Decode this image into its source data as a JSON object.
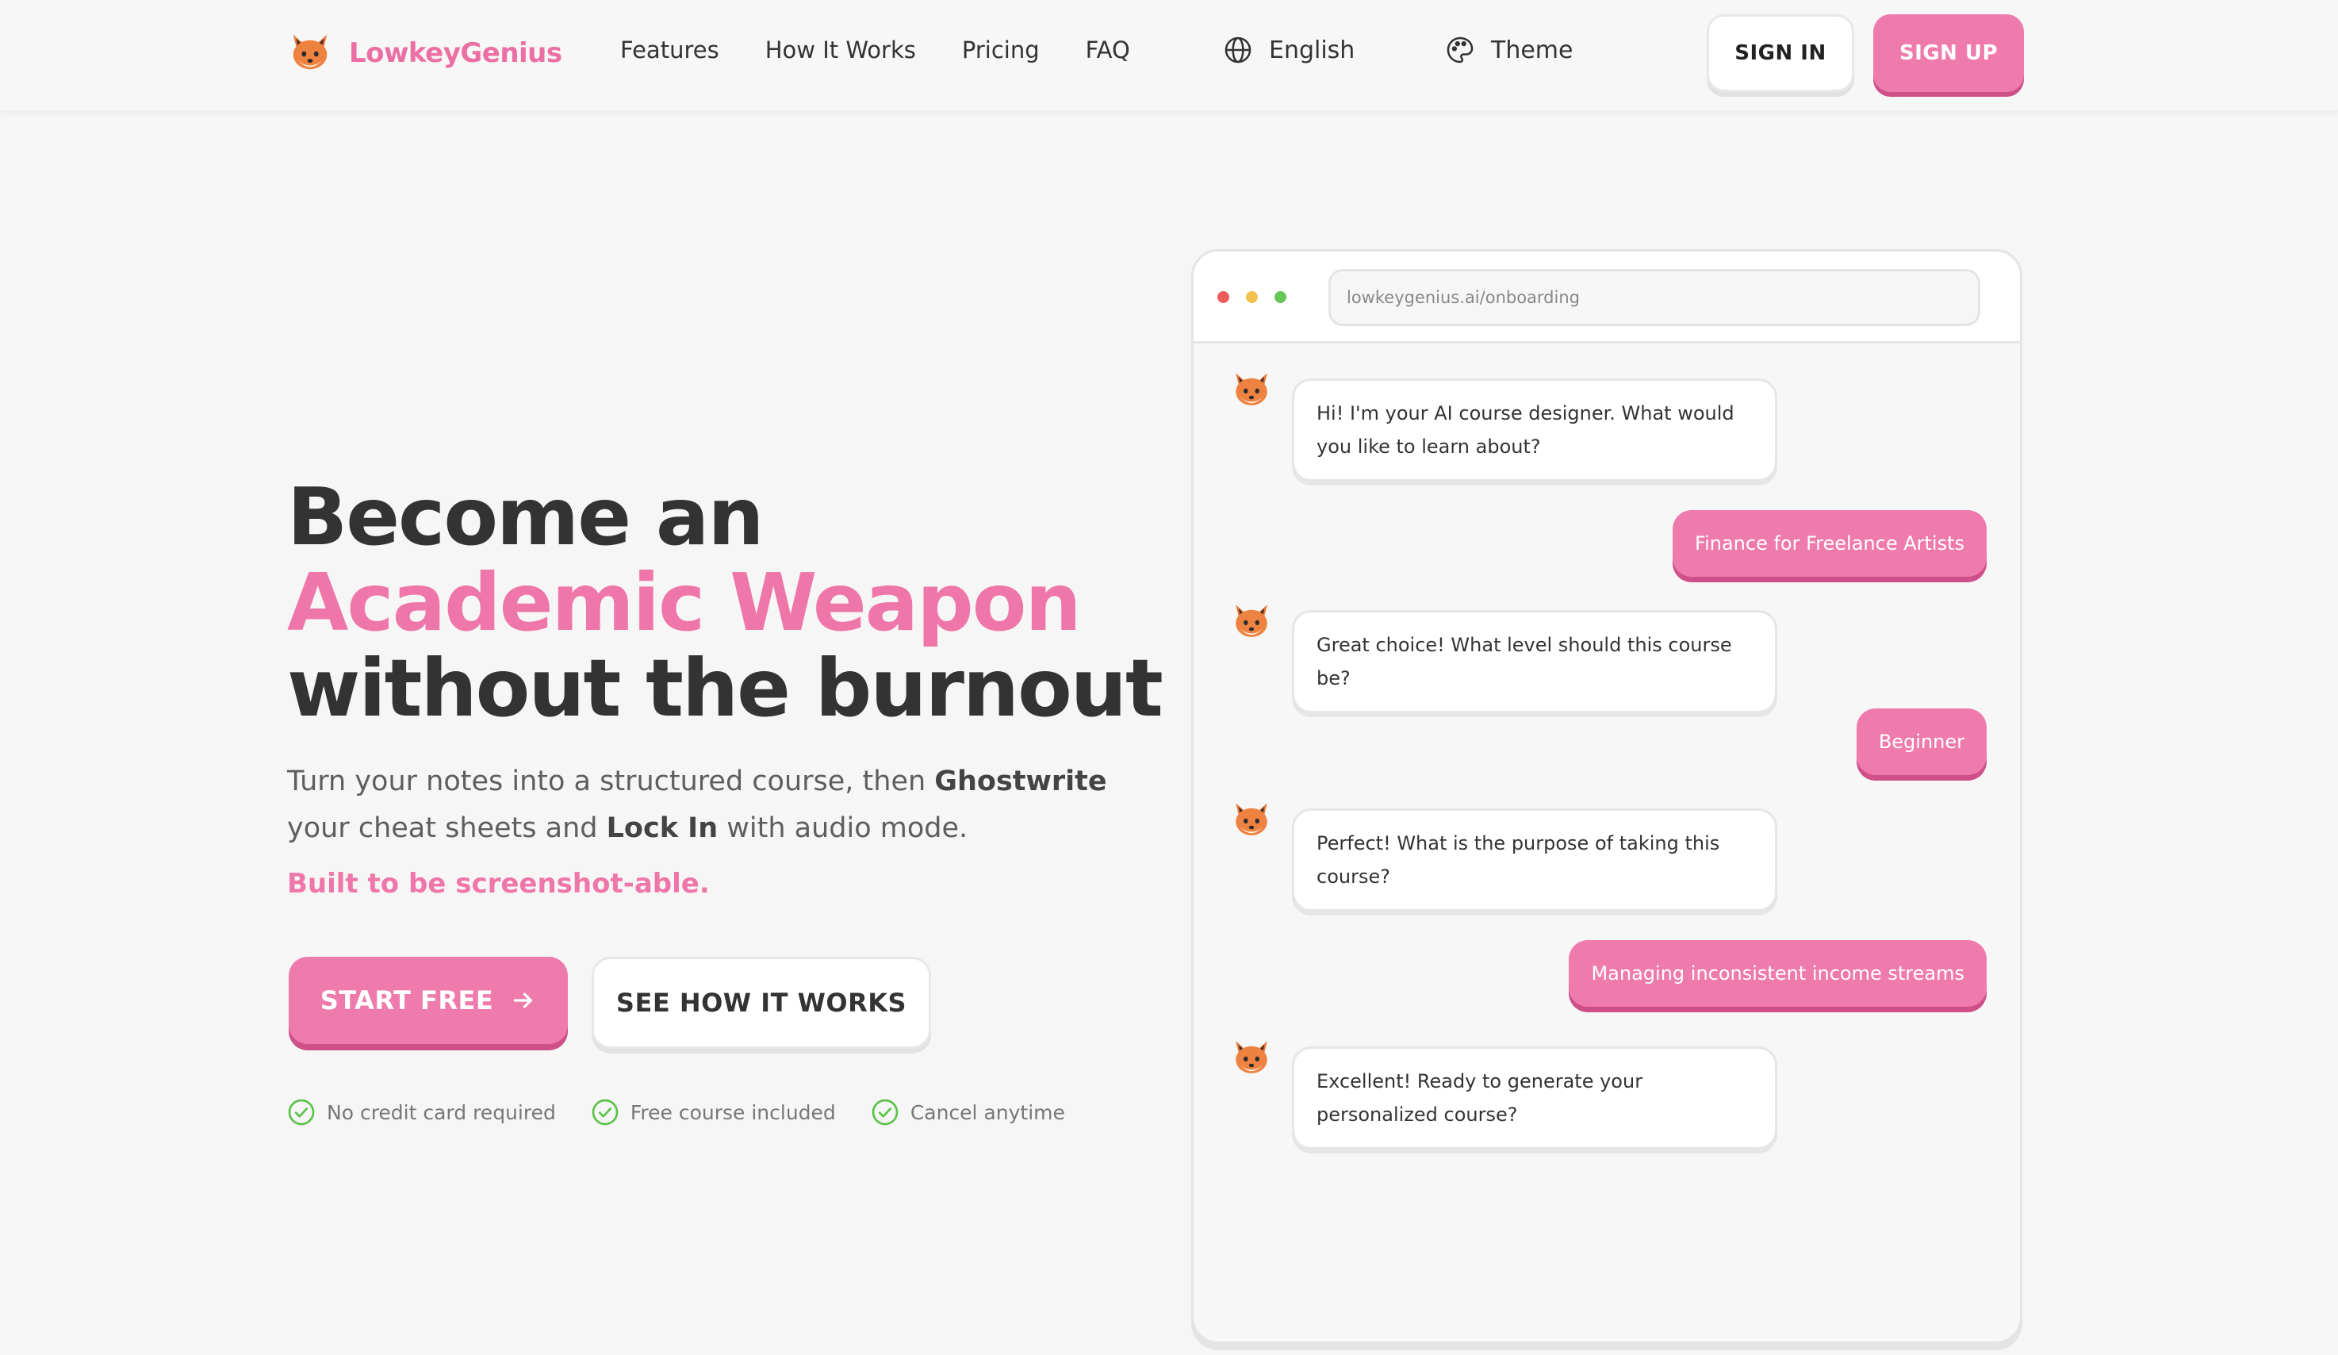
{
  "brand": {
    "name": "LowkeyGenius",
    "logo_icon": "fox-icon"
  },
  "nav": {
    "links": [
      "Features",
      "How It Works",
      "Pricing",
      "FAQ"
    ],
    "language": "English",
    "theme": "Theme",
    "sign_in": "SIGN IN",
    "sign_up": "SIGN UP"
  },
  "hero": {
    "title_line1": "Become an",
    "title_line2": "Academic Weapon",
    "title_line3": "without the burnout",
    "sub_part1": "Turn your notes into a structured course, then ",
    "sub_bold1": "Ghostwrite",
    "sub_part2": " your cheat sheets and ",
    "sub_bold2": "Lock In",
    "sub_part3": " with audio mode.",
    "tagline": "Built to be screenshot-able.",
    "cta_primary": "START FREE",
    "cta_secondary": "SEE HOW IT WORKS",
    "perks": [
      "No credit card required",
      "Free course included",
      "Cancel anytime"
    ]
  },
  "mock": {
    "url": "lowkeygenius.ai/onboarding",
    "messages": [
      {
        "from": "bot",
        "text": "Hi! I'm your AI course designer. What would you like to learn about?"
      },
      {
        "from": "user",
        "text": "Finance for Freelance Artists"
      },
      {
        "from": "bot",
        "text": "Great choice! What level should this course be?"
      },
      {
        "from": "user",
        "text": "Beginner"
      },
      {
        "from": "bot",
        "text": "Perfect! What is the purpose of taking this course?"
      },
      {
        "from": "user",
        "text": "Managing inconsistent income streams"
      },
      {
        "from": "bot",
        "text": "Excellent! Ready to generate your personalized course?"
      }
    ]
  },
  "colors": {
    "accent": "#ef7bad",
    "accent_shadow": "#cf4f88",
    "check": "#5cc24a",
    "text": "#333333"
  }
}
